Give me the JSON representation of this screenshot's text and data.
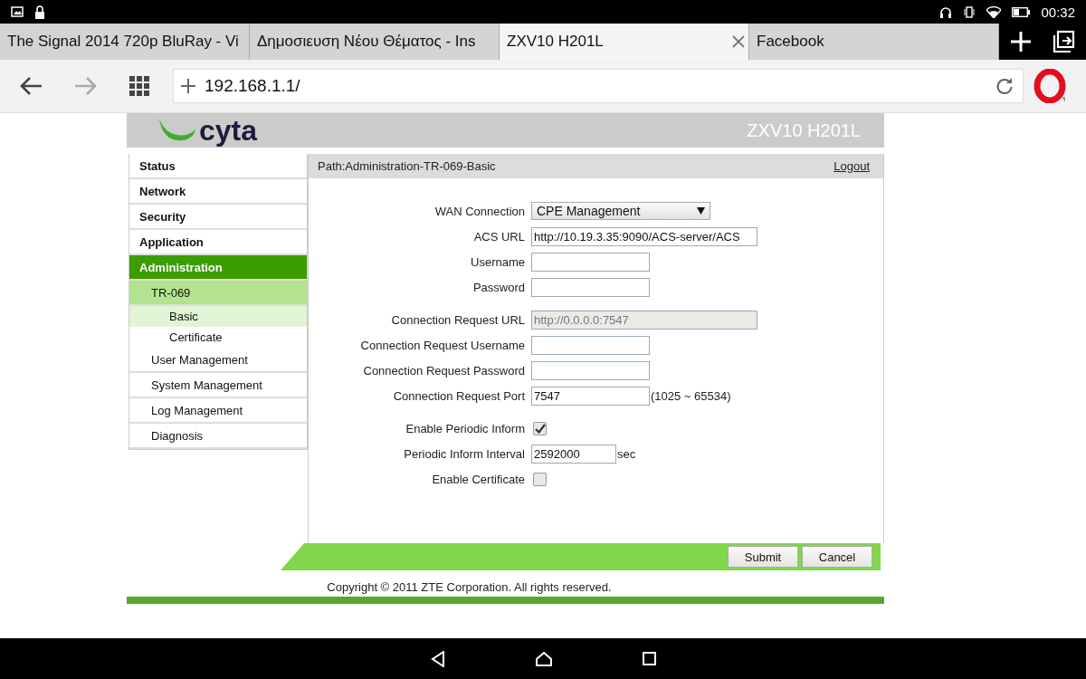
{
  "status_bar": {
    "time": "00:32"
  },
  "tabs": [
    {
      "label": "The Signal 2014 720p BluRay - Vi",
      "selected": false
    },
    {
      "label": "Δημοσιευση Νέου Θέματος - Ins",
      "selected": false
    },
    {
      "label": "ZXV10 H201L",
      "selected": true
    },
    {
      "label": "Facebook",
      "selected": false
    }
  ],
  "address_bar": {
    "url": "192.168.1.1/"
  },
  "page": {
    "logo": "cyta",
    "model": "ZXV10 H201L",
    "path": "Path:Administration-TR-069-Basic",
    "logout": "Logout",
    "sidebar": [
      {
        "label": "Status",
        "selected": false
      },
      {
        "label": "Network",
        "selected": false
      },
      {
        "label": "Security",
        "selected": false
      },
      {
        "label": "Application",
        "selected": false
      },
      {
        "label": "Administration",
        "selected": true,
        "children": [
          {
            "label": "TR-069",
            "selected": true,
            "children": [
              {
                "label": "Basic",
                "selected": true
              },
              {
                "label": "Certificate",
                "selected": false
              }
            ]
          },
          {
            "label": "User Management",
            "selected": false
          },
          {
            "label": "System Management",
            "selected": false
          },
          {
            "label": "Log Management",
            "selected": false
          },
          {
            "label": "Diagnosis",
            "selected": false
          }
        ]
      }
    ],
    "form": [
      [
        {
          "kind": "select",
          "label": "WAN Connection",
          "value": "CPE Management"
        },
        {
          "kind": "longtext",
          "label": "ACS URL",
          "value": "http://10.19.3.35:9090/ACS-server/ACS",
          "disabled": false
        },
        {
          "kind": "text",
          "label": "Username",
          "disabled": false
        },
        {
          "kind": "text",
          "label": "Password",
          "disabled": false
        }
      ],
      [
        {
          "kind": "longtext",
          "label": "Connection Request URL",
          "value": "http://0.0.0.0:7547",
          "disabled": true
        },
        {
          "kind": "text",
          "label": "Connection Request Username",
          "disabled": false
        },
        {
          "kind": "text",
          "label": "Connection Request Password",
          "disabled": false
        },
        {
          "kind": "text",
          "label": "Connection Request Port",
          "value": "7547",
          "disabled": false,
          "suffix": "(1025 ~ 65534)"
        }
      ],
      [
        {
          "kind": "checkbox",
          "label": "Enable Periodic Inform",
          "checked": true
        },
        {
          "kind": "shorttext",
          "label": "Periodic Inform Interval",
          "value": "2592000",
          "disabled": false,
          "suffix": "sec"
        },
        {
          "kind": "checkbox",
          "label": "Enable Certificate",
          "checked": false
        }
      ]
    ],
    "buttons": [
      "Submit",
      "Cancel"
    ],
    "copyright": "Copyright © 2011 ZTE Corporation. All rights reserved."
  }
}
